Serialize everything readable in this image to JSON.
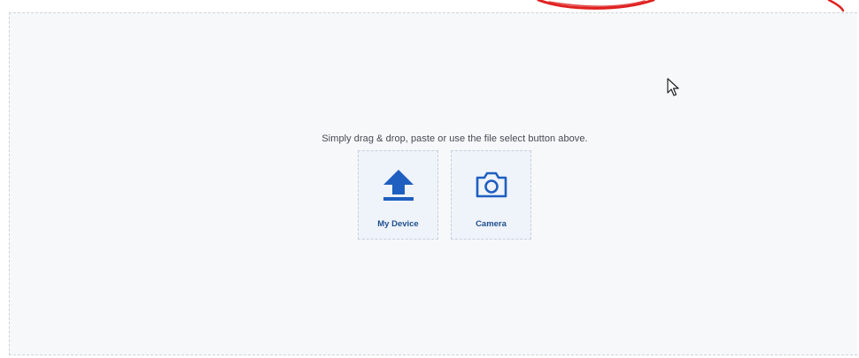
{
  "drop_zone": {
    "hint": "Simply drag & drop, paste or use the file select button above."
  },
  "sources": [
    {
      "label": "My Device",
      "icon": "upload-arrow-icon"
    },
    {
      "label": "Camera",
      "icon": "camera-icon"
    }
  ],
  "colors": {
    "accent": "#1f5fbf",
    "label": "#1f4f8f",
    "drop_zone_bg": "#f7f8fa",
    "tile_bg": "#eff3fa",
    "annotation_red": "#e02020"
  }
}
